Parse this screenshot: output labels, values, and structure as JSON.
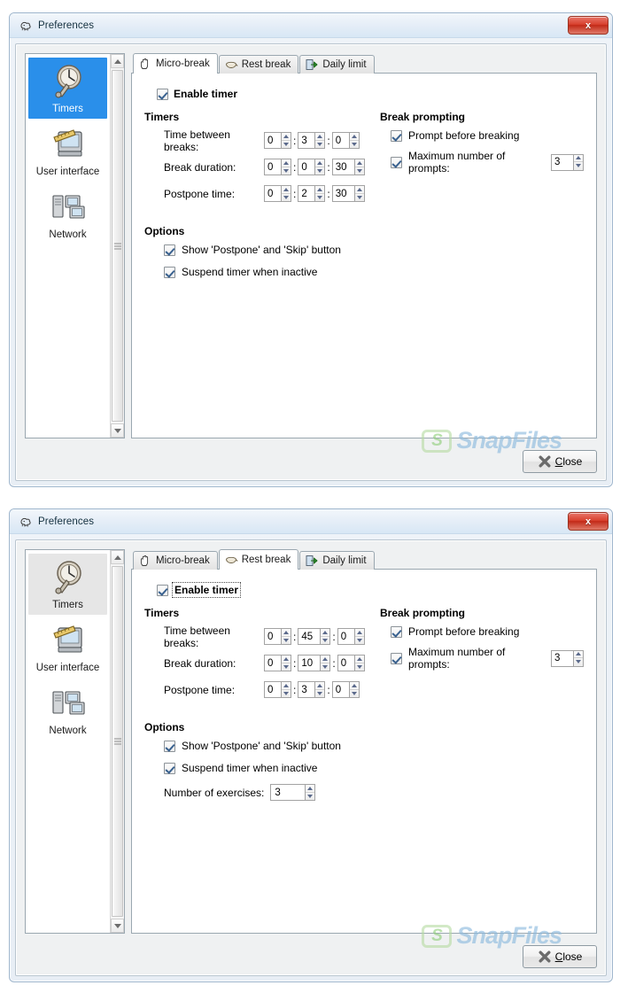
{
  "window_title": "Preferences",
  "title_icon": "workrave-sheep-icon",
  "close_box_label": "x",
  "sidebar": {
    "items": [
      {
        "label": "Timers",
        "icon": "clock-wrench-icon"
      },
      {
        "label": "User interface",
        "icon": "monitor-ruler-icon"
      },
      {
        "label": "Network",
        "icon": "network-computers-icon"
      }
    ]
  },
  "tabs": [
    {
      "label": "Micro-break",
      "icon": "hand-icon"
    },
    {
      "label": "Rest break",
      "icon": "coffee-cup-icon"
    },
    {
      "label": "Daily limit",
      "icon": "green-exit-arrow-icon"
    }
  ],
  "labels": {
    "enable_timer": "Enable timer",
    "timers_group": "Timers",
    "break_prompting_group": "Break prompting",
    "options_group": "Options",
    "time_between_breaks": "Time between breaks:",
    "break_duration": "Break duration:",
    "postpone_time": "Postpone time:",
    "prompt_before_breaking": "Prompt before breaking",
    "maximum_number_of_prompts": "Maximum number of prompts:",
    "show_postpone_skip": "Show 'Postpone' and 'Skip' button",
    "suspend_timer_inactive": "Suspend timer when inactive",
    "number_of_exercises": "Number of exercises:"
  },
  "footer": {
    "close_button": "Close",
    "close_button_accel": "C",
    "close_button_rest": "lose",
    "watermark_mark": "S",
    "watermark_text": "SnapFiles"
  },
  "colors": {
    "selection_focus": "#2a8fea",
    "selection_blur": "#e6e6e6",
    "titlebar_top": "#f2f7fb",
    "close_red": "#d9412e",
    "watermark_blue": "#8ab9de",
    "watermark_green": "#8fcf7a"
  },
  "window_a": {
    "active_tab_index": 0,
    "sidebar_selected_index": 0,
    "sidebar_focused": true,
    "enable_timer_checked": true,
    "enable_timer_focused": false,
    "timers": {
      "time_between_breaks": {
        "h": "0",
        "m": "3",
        "s": "0"
      },
      "break_duration": {
        "h": "0",
        "m": "0",
        "s": "30"
      },
      "postpone_time": {
        "h": "0",
        "m": "2",
        "s": "30"
      }
    },
    "prompting": {
      "prompt_before_breaking_checked": true,
      "maximum_number_of_prompts_checked": true,
      "maximum_number_of_prompts_value": "3"
    },
    "options": {
      "show_postpone_skip_checked": true,
      "suspend_timer_inactive_checked": true,
      "has_number_of_exercises": false,
      "number_of_exercises_value": ""
    }
  },
  "window_b": {
    "active_tab_index": 1,
    "sidebar_selected_index": 0,
    "sidebar_focused": false,
    "enable_timer_checked": true,
    "enable_timer_focused": true,
    "timers": {
      "time_between_breaks": {
        "h": "0",
        "m": "45",
        "s": "0"
      },
      "break_duration": {
        "h": "0",
        "m": "10",
        "s": "0"
      },
      "postpone_time": {
        "h": "0",
        "m": "3",
        "s": "0"
      }
    },
    "prompting": {
      "prompt_before_breaking_checked": true,
      "maximum_number_of_prompts_checked": true,
      "maximum_number_of_prompts_value": "3"
    },
    "options": {
      "show_postpone_skip_checked": true,
      "suspend_timer_inactive_checked": true,
      "has_number_of_exercises": true,
      "number_of_exercises_value": "3"
    }
  }
}
